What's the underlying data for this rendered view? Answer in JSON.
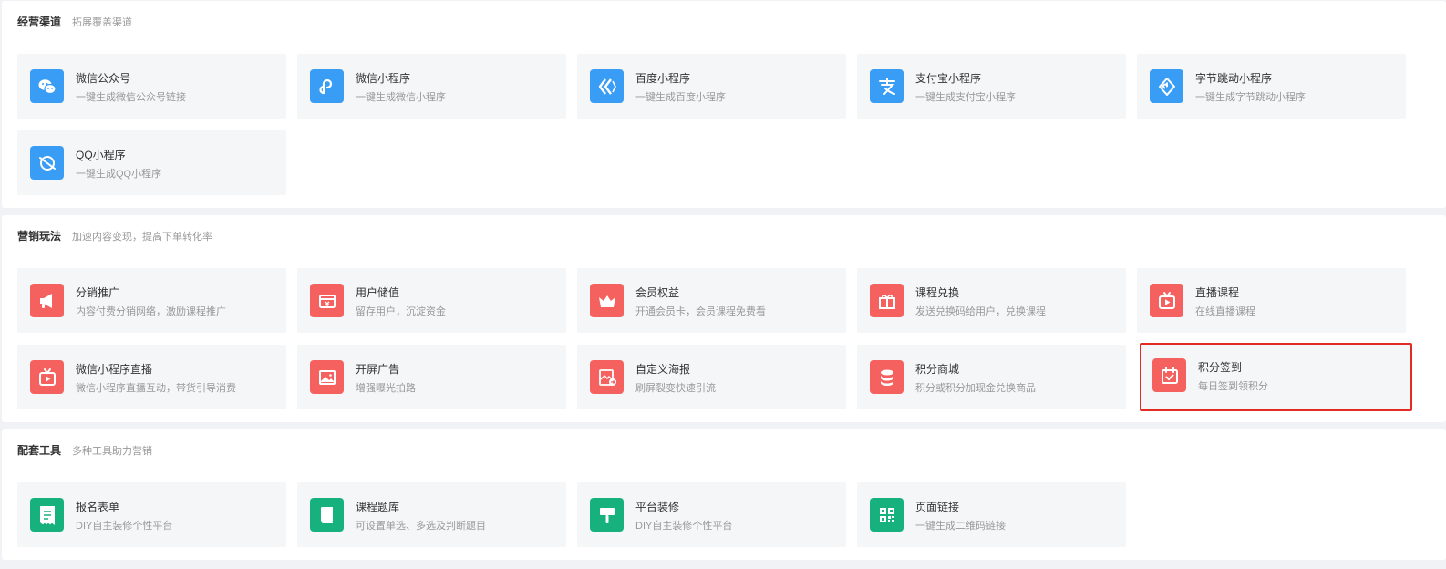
{
  "sections": [
    {
      "title": "经营渠道",
      "subtitle": "拓展覆盖渠道",
      "cards": [
        {
          "title": "微信公众号",
          "desc": "一键生成微信公众号链接",
          "icon": "wechat-icon",
          "color": "#3a9df5"
        },
        {
          "title": "微信小程序",
          "desc": "一键生成微信小程序",
          "icon": "mini-program-icon",
          "color": "#3a9df5"
        },
        {
          "title": "百度小程序",
          "desc": "一键生成百度小程序",
          "icon": "baidu-icon",
          "color": "#3a9df5"
        },
        {
          "title": "支付宝小程序",
          "desc": "一键生成支付宝小程序",
          "icon": "alipay-icon",
          "color": "#3a9df5"
        },
        {
          "title": "字节跳动小程序",
          "desc": "一键生成字节跳动小程序",
          "icon": "bytedance-icon",
          "color": "#3a9df5"
        },
        {
          "title": "QQ小程序",
          "desc": "一键生成QQ小程序",
          "icon": "qq-planet-icon",
          "color": "#3a9df5"
        }
      ]
    },
    {
      "title": "营销玩法",
      "subtitle": "加速内容变现，提高下单转化率",
      "cards": [
        {
          "title": "分销推广",
          "desc": "内容付费分销网络，激励课程推广",
          "icon": "megaphone-icon",
          "color": "#f4615e"
        },
        {
          "title": "用户储值",
          "desc": "留存用户，沉淀资金",
          "icon": "wallet-icon",
          "color": "#f4615e"
        },
        {
          "title": "会员权益",
          "desc": "开通会员卡，会员课程免费看",
          "icon": "crown-icon",
          "color": "#f4615e"
        },
        {
          "title": "课程兑换",
          "desc": "发送兑换码给用户，兑换课程",
          "icon": "gift-icon",
          "color": "#f4615e"
        },
        {
          "title": "直播课程",
          "desc": "在线直播课程",
          "icon": "live-tv-icon",
          "color": "#f4615e"
        },
        {
          "title": "微信小程序直播",
          "desc": "微信小程序直播互动，带货引导消费",
          "icon": "live-tv-icon",
          "color": "#f4615e"
        },
        {
          "title": "开屏广告",
          "desc": "增强曝光拍路",
          "icon": "image-icon",
          "color": "#f4615e"
        },
        {
          "title": "自定义海报",
          "desc": "刷屏裂变快速引流",
          "icon": "poster-share-icon",
          "color": "#f4615e"
        },
        {
          "title": "积分商城",
          "desc": "积分或积分加现金兑换商品",
          "icon": "coins-icon",
          "color": "#f4615e"
        },
        {
          "title": "积分签到",
          "desc": "每日签到领积分",
          "icon": "calendar-check-icon",
          "color": "#f4615e",
          "highlighted": true
        }
      ]
    },
    {
      "title": "配套工具",
      "subtitle": "多种工具助力营销",
      "cards": [
        {
          "title": "报名表单",
          "desc": "DIY自主装修个性平台",
          "icon": "form-icon",
          "color": "#17b17e"
        },
        {
          "title": "课程题库",
          "desc": "可设置单选、多选及判断题目",
          "icon": "book-icon",
          "color": "#17b17e"
        },
        {
          "title": "平台装修",
          "desc": "DIY自主装修个性平台",
          "icon": "paint-roller-icon",
          "color": "#17b17e"
        },
        {
          "title": "页面链接",
          "desc": "一键生成二维码链接",
          "icon": "qrcode-icon",
          "color": "#17b17e"
        }
      ]
    }
  ]
}
